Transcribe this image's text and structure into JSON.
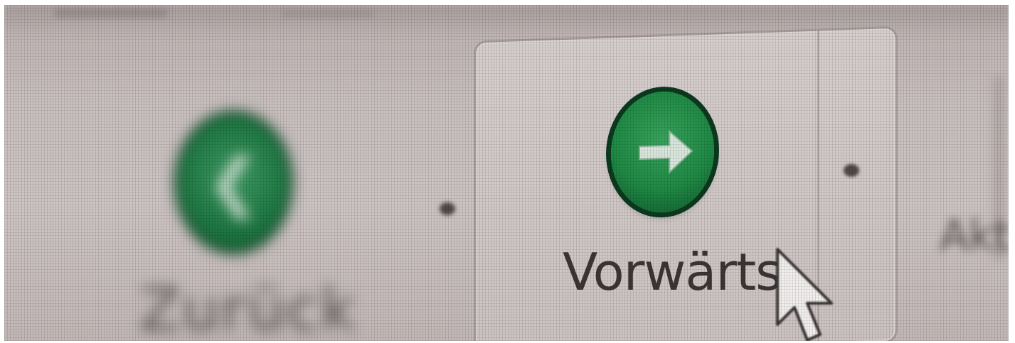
{
  "toolbar": {
    "back_label": "Zurück",
    "forward_label": "Vorwärts",
    "next_label": "Akt"
  },
  "icons": {
    "back": "arrow-left-icon",
    "forward": "arrow-right-icon",
    "dropdown": "dropdown-dot-icon",
    "cursor": "mouse-pointer-icon"
  },
  "colors": {
    "toolbar_bg": "#c9c0bf",
    "icon_green": "#1f8a45",
    "icon_dark": "#0b3a1e",
    "arrow_fill": "#d8e6dc",
    "label_text": "#3c3535"
  }
}
